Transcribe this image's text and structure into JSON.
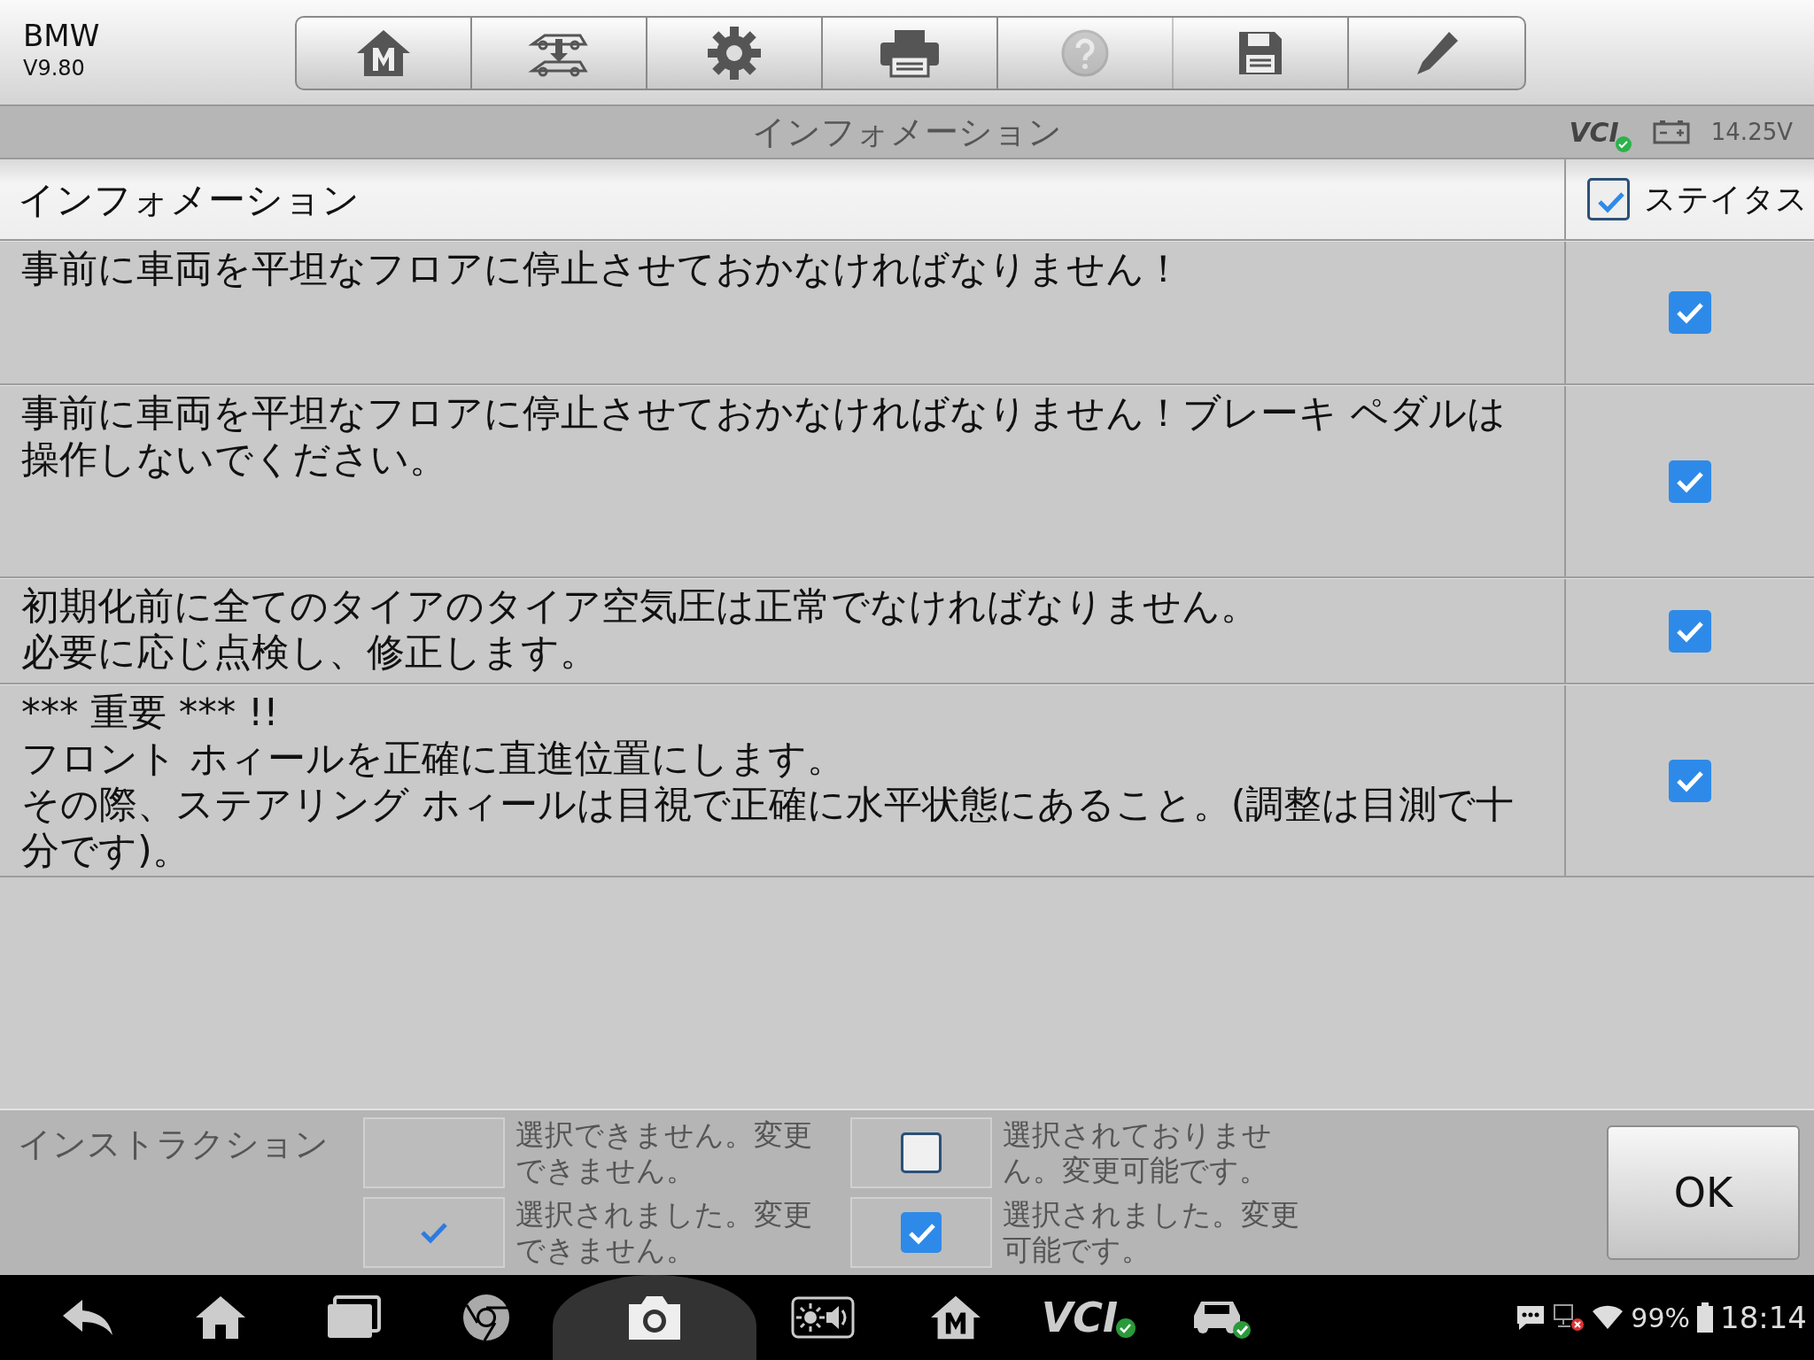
{
  "app": {
    "brand": "BMW",
    "version": "V9.80"
  },
  "toolbar": [
    {
      "kind": "home-m",
      "disabled": false
    },
    {
      "kind": "cars",
      "disabled": false
    },
    {
      "kind": "gear",
      "disabled": false
    },
    {
      "kind": "printer",
      "disabled": false
    },
    {
      "kind": "help",
      "disabled": true
    },
    {
      "kind": "save",
      "disabled": false
    },
    {
      "kind": "pen",
      "disabled": false
    }
  ],
  "title_bar": {
    "title": "インフォメーション",
    "vci": "VCI",
    "voltage": "14.25V"
  },
  "table": {
    "header": "インフォメーション",
    "status_header": {
      "label": "ステイタス",
      "checked": true
    },
    "rows": [
      {
        "text": "事前に車両を平坦なフロアに停止させておかなければなりません！",
        "checked": true
      },
      {
        "text": "事前に車両を平坦なフロアに停止させておかなければなりません！ブレーキ ペダルは操作しないでください。",
        "checked": true
      },
      {
        "lines": [
          "初期化前に全てのタイアのタイア空気圧は正常でなければなりません。",
          "必要に応じ点検し、修正します。"
        ],
        "checked": true
      },
      {
        "lines": [
          "*** 重要 *** !!",
          "フロント ホィールを正確に直進位置にします。",
          "その際、ステアリング ホィールは目視で正確に水平状態にあること。(調整は目測で十分です)。"
        ],
        "checked": true
      }
    ]
  },
  "instructions": {
    "label": "インストラクション",
    "items": [
      {
        "text": "選択できません。変更できません。",
        "checked": false,
        "editable": false
      },
      {
        "text": "選択されておりません。変更可能です。",
        "checked": false,
        "editable": true
      },
      {
        "text": "選択されました。変更できません。",
        "checked": true,
        "editable": false
      },
      {
        "text": "選択されました。変更可能です。",
        "checked": true,
        "editable": true
      }
    ]
  },
  "ok_button": "OK",
  "taskbar": [
    {
      "kind": "back",
      "selected": false
    },
    {
      "kind": "home",
      "selected": false
    },
    {
      "kind": "recents",
      "selected": false
    },
    {
      "kind": "browser",
      "selected": false
    },
    {
      "kind": "camera",
      "selected": true
    },
    {
      "kind": "brightness",
      "selected": false
    },
    {
      "kind": "home-m",
      "selected": false
    },
    {
      "kind": "vci",
      "label": "VCI",
      "selected": false
    },
    {
      "kind": "car",
      "selected": false
    }
  ],
  "status": {
    "battery": "99%",
    "time": "18:14"
  }
}
